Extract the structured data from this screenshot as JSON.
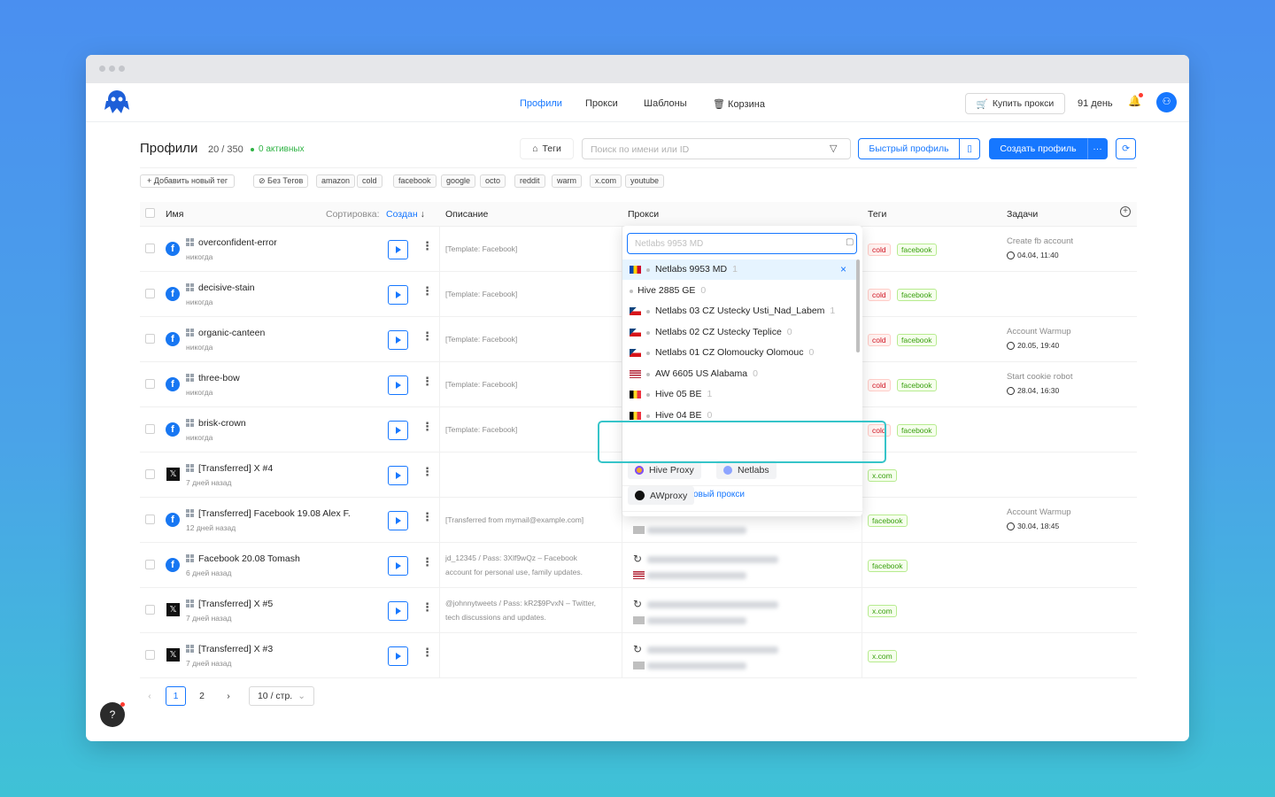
{
  "nav": {
    "links": [
      "Профили",
      "Прокси",
      "Шаблоны",
      "Корзина"
    ],
    "buy_proxy": "Купить прокси",
    "days": "91 день"
  },
  "page": {
    "title": "Профили",
    "count": "20 / 350",
    "active": "0 активных",
    "tags_btn": "Теги",
    "search_placeholder": "Поиск по имени или ID",
    "quick_profile": "Быстрый профиль",
    "create_profile": "Создать профиль"
  },
  "tagbar": {
    "add": "Добавить новый тег",
    "no_tags": "Без Тегов",
    "tags": [
      "amazon",
      "cold",
      "facebook",
      "google",
      "octo",
      "reddit",
      "warm",
      "x.com",
      "youtube"
    ]
  },
  "table": {
    "headers": {
      "name": "Имя",
      "sort_label": "Сортировка:",
      "sort_value": "Создан",
      "description": "Описание",
      "proxy": "Прокси",
      "tags": "Теги",
      "tasks": "Задачи"
    },
    "rows": [
      {
        "icon": "facebook",
        "name": "overconfident-error",
        "sub": "никогда",
        "desc": "[Template: Facebook]",
        "desc2": "",
        "tags": [
          "cold",
          "facebook"
        ],
        "task": "Create fb account",
        "task_date": "04.04, 11:40"
      },
      {
        "icon": "facebook",
        "name": "decisive-stain",
        "sub": "никогда",
        "desc": "[Template: Facebook]",
        "desc2": "",
        "tags": [
          "cold",
          "facebook"
        ],
        "task": "",
        "task_date": ""
      },
      {
        "icon": "facebook",
        "name": "organic-canteen",
        "sub": "никогда",
        "desc": "[Template: Facebook]",
        "desc2": "",
        "tags": [
          "cold",
          "facebook"
        ],
        "task": "Account Warmup",
        "task_date": "20.05, 19:40"
      },
      {
        "icon": "facebook",
        "name": "three-bow",
        "sub": "никогда",
        "desc": "[Template: Facebook]",
        "desc2": "",
        "tags": [
          "cold",
          "facebook"
        ],
        "task": "Start cookie robot",
        "task_date": "28.04, 16:30"
      },
      {
        "icon": "facebook",
        "name": "brisk-crown",
        "sub": "никогда",
        "desc": "[Template: Facebook]",
        "desc2": "",
        "tags": [
          "cold",
          "facebook"
        ],
        "task": "",
        "task_date": ""
      },
      {
        "icon": "x",
        "name": "[Transferred] X #4",
        "sub": "7 дней назад",
        "desc": "",
        "desc2": "",
        "tags": [
          "x.com"
        ],
        "task": "",
        "task_date": ""
      },
      {
        "icon": "facebook",
        "name": "[Transferred] Facebook 19.08 Alex F.",
        "sub": "12 дней назад",
        "desc": "[Transferred from mymail@example.com]",
        "desc2": "",
        "tags": [
          "facebook"
        ],
        "task": "Account Warmup",
        "task_date": "30.04, 18:45"
      },
      {
        "icon": "facebook",
        "name": "Facebook 20.08 Tomash",
        "sub": "6 дней назад",
        "desc": "jd_12345 / Pass: 3Xlf9wQz – Facebook",
        "desc2": "account for personal use, family updates.",
        "tags": [
          "facebook"
        ],
        "task": "",
        "task_date": ""
      },
      {
        "icon": "x",
        "name": "[Transferred] X #5",
        "sub": "7 дней назад",
        "desc": "@johnnytweets / Pass: kR2$9PvxN – Twitter,",
        "desc2": "tech discussions and updates.",
        "tags": [
          "x.com"
        ],
        "task": "",
        "task_date": ""
      },
      {
        "icon": "x",
        "name": "[Transferred] X #3",
        "sub": "7 дней назад",
        "desc": "",
        "desc2": "",
        "tags": [
          "x.com"
        ],
        "task": "",
        "task_date": ""
      }
    ]
  },
  "dropdown": {
    "input_value": "Netlabs 9953 MD",
    "items": [
      {
        "flag": "md",
        "name": "Netlabs 9953 MD",
        "count": "1",
        "selected": true
      },
      {
        "flag": "",
        "name": "Hive 2885 GE",
        "count": "0"
      },
      {
        "flag": "cz",
        "name": "Netlabs 03 CZ Ustecky Usti_Nad_Labem",
        "count": "1"
      },
      {
        "flag": "cz",
        "name": "Netlabs 02 CZ Ustecky Teplice",
        "count": "0"
      },
      {
        "flag": "cz",
        "name": "Netlabs 01 CZ Olomoucky Olomouc",
        "count": "0"
      },
      {
        "flag": "us",
        "name": "AW 6605 US Alabama",
        "count": "0"
      },
      {
        "flag": "be",
        "name": "Hive 05 BE",
        "count": "1"
      },
      {
        "flag": "be",
        "name": "Hive 04 BE",
        "count": "0"
      }
    ],
    "install": "Установить новый прокси",
    "providers": [
      "Hive Proxy",
      "Netlabs",
      "AWproxy"
    ]
  },
  "pagination": {
    "pages": [
      "1",
      "2"
    ],
    "page_size": "10 / стр."
  },
  "help": "?"
}
